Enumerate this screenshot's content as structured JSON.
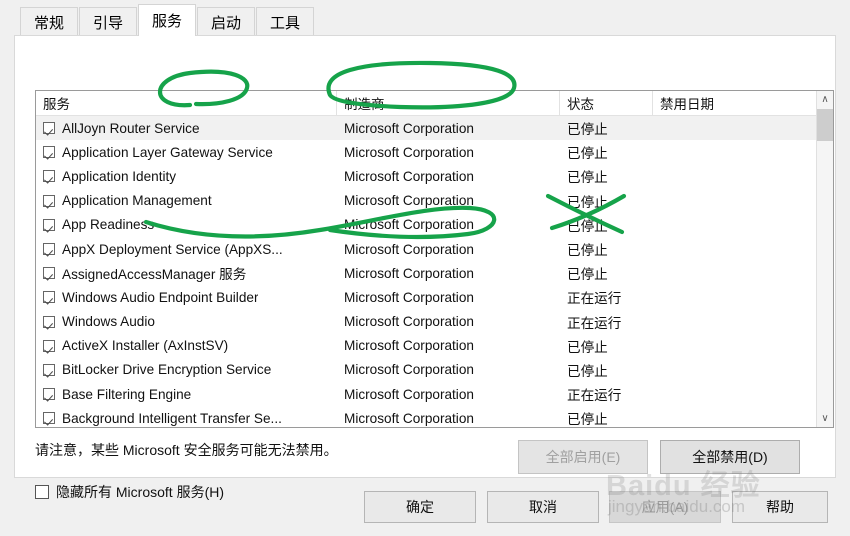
{
  "tabs": [
    {
      "label": "常规",
      "active": false
    },
    {
      "label": "引导",
      "active": false
    },
    {
      "label": "服务",
      "active": true
    },
    {
      "label": "启动",
      "active": false
    },
    {
      "label": "工具",
      "active": false
    }
  ],
  "table": {
    "columns": [
      {
        "key": "name",
        "label": "服务"
      },
      {
        "key": "maker",
        "label": "制造商"
      },
      {
        "key": "state",
        "label": "状态"
      },
      {
        "key": "date",
        "label": "禁用日期"
      }
    ],
    "rows": [
      {
        "checked": true,
        "name": "AllJoyn Router Service",
        "maker": "Microsoft Corporation",
        "state": "已停止",
        "date": "",
        "selected": true
      },
      {
        "checked": true,
        "name": "Application Layer Gateway Service",
        "maker": "Microsoft Corporation",
        "state": "已停止",
        "date": "",
        "selected": false
      },
      {
        "checked": true,
        "name": "Application Identity",
        "maker": "Microsoft Corporation",
        "state": "已停止",
        "date": "",
        "selected": false
      },
      {
        "checked": true,
        "name": "Application Management",
        "maker": "Microsoft Corporation",
        "state": "已停止",
        "date": "",
        "selected": false
      },
      {
        "checked": true,
        "name": "App Readiness",
        "maker": "Microsoft Corporation",
        "state": "已停止",
        "date": "",
        "selected": false
      },
      {
        "checked": true,
        "name": "AppX Deployment Service (AppXS...",
        "maker": "Microsoft Corporation",
        "state": "已停止",
        "date": "",
        "selected": false
      },
      {
        "checked": true,
        "name": "AssignedAccessManager 服务",
        "maker": "Microsoft Corporation",
        "state": "已停止",
        "date": "",
        "selected": false
      },
      {
        "checked": true,
        "name": "Windows Audio Endpoint Builder",
        "maker": "Microsoft Corporation",
        "state": "正在运行",
        "date": "",
        "selected": false
      },
      {
        "checked": true,
        "name": "Windows Audio",
        "maker": "Microsoft Corporation",
        "state": "正在运行",
        "date": "",
        "selected": false
      },
      {
        "checked": true,
        "name": "ActiveX Installer (AxInstSV)",
        "maker": "Microsoft Corporation",
        "state": "已停止",
        "date": "",
        "selected": false
      },
      {
        "checked": true,
        "name": "BitLocker Drive Encryption Service",
        "maker": "Microsoft Corporation",
        "state": "已停止",
        "date": "",
        "selected": false
      },
      {
        "checked": true,
        "name": "Base Filtering Engine",
        "maker": "Microsoft Corporation",
        "state": "正在运行",
        "date": "",
        "selected": false
      },
      {
        "checked": true,
        "name": "Background Intelligent Transfer Se...",
        "maker": "Microsoft Corporation",
        "state": "已停止",
        "date": "",
        "selected": false
      }
    ]
  },
  "scrollbar": {
    "up_icon": "chevron-up-icon",
    "down_icon": "chevron-down-icon",
    "up_glyph": "∧",
    "down_glyph": "∨"
  },
  "note": "请注意，某些 Microsoft 安全服务可能无法禁用。",
  "hide_microsoft": {
    "label": "隐藏所有 Microsoft 服务(H)",
    "checked": false
  },
  "panel_buttons": {
    "enable_all": {
      "label": "全部启用(E)",
      "disabled": true
    },
    "disable_all": {
      "label": "全部禁用(D)",
      "disabled": false
    }
  },
  "footer_buttons": {
    "ok": {
      "label": "确定",
      "disabled": false
    },
    "cancel": {
      "label": "取消",
      "disabled": false
    },
    "apply": {
      "label": "应用(A)",
      "disabled": true
    },
    "help": {
      "label": "帮助",
      "disabled": false
    }
  },
  "watermark": {
    "line1": "Baidu 经验",
    "line2": "jingyan.baidu.com"
  },
  "annotations": {
    "ink_color": "#16a34a",
    "marks": [
      {
        "name": "ellipse-router-service"
      },
      {
        "name": "ellipse-microsoft-corporation"
      },
      {
        "name": "squiggle-appx-rows"
      },
      {
        "name": "cross-status-column"
      }
    ]
  }
}
